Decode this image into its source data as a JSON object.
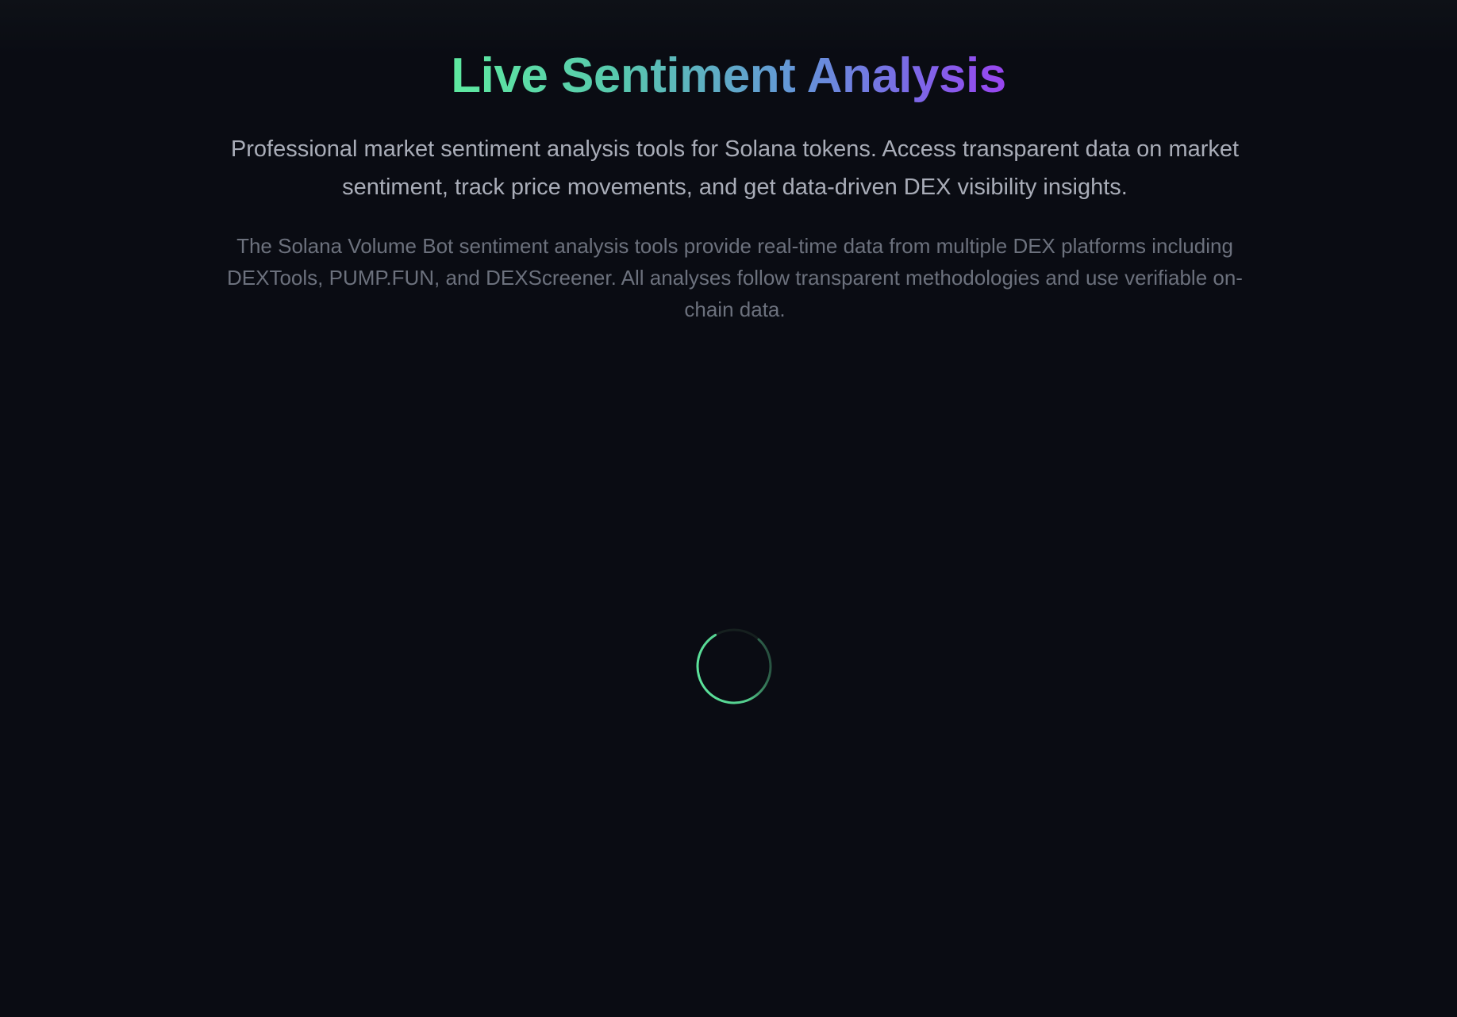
{
  "hero": {
    "title": "Live Sentiment Analysis",
    "lead": "Professional market sentiment analysis tools for Solana tokens. Access transparent data on market sentiment, track price movements, and get data-driven DEX visibility insights.",
    "description": "The Solana Volume Bot sentiment analysis tools provide real-time data from multiple DEX platforms including DEXTools, PUMP.FUN, and DEXScreener. All analyses follow transparent methodologies and use verifiable on-chain data."
  },
  "loading": {
    "icon": "loading-spinner-icon",
    "color": "#5eeaa0"
  },
  "colors": {
    "background": "#0a0c13",
    "gradient_start": "#5eeaa0",
    "gradient_end": "#9945f0",
    "lead_text": "#a9adb8",
    "muted_text": "#6c717d"
  }
}
